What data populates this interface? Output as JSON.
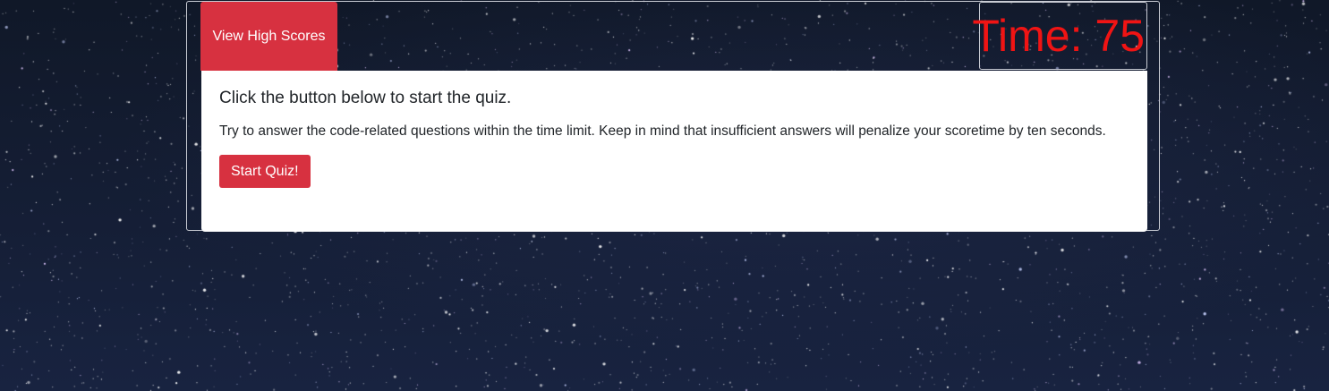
{
  "header": {
    "high_scores_label": "View High Scores",
    "timer_text": "Time: 75"
  },
  "card": {
    "title": "Click the button below to start the quiz.",
    "text": "Try to answer the code-related questions within the time limit. Keep in mind that insufficient answers will penalize your scoretime by ten seconds.",
    "start_label": "Start Quiz!"
  },
  "colors": {
    "accent_red": "#d73140",
    "timer_red": "#f01414",
    "card_bg": "#ffffff",
    "sky_dark": "#141d33"
  }
}
